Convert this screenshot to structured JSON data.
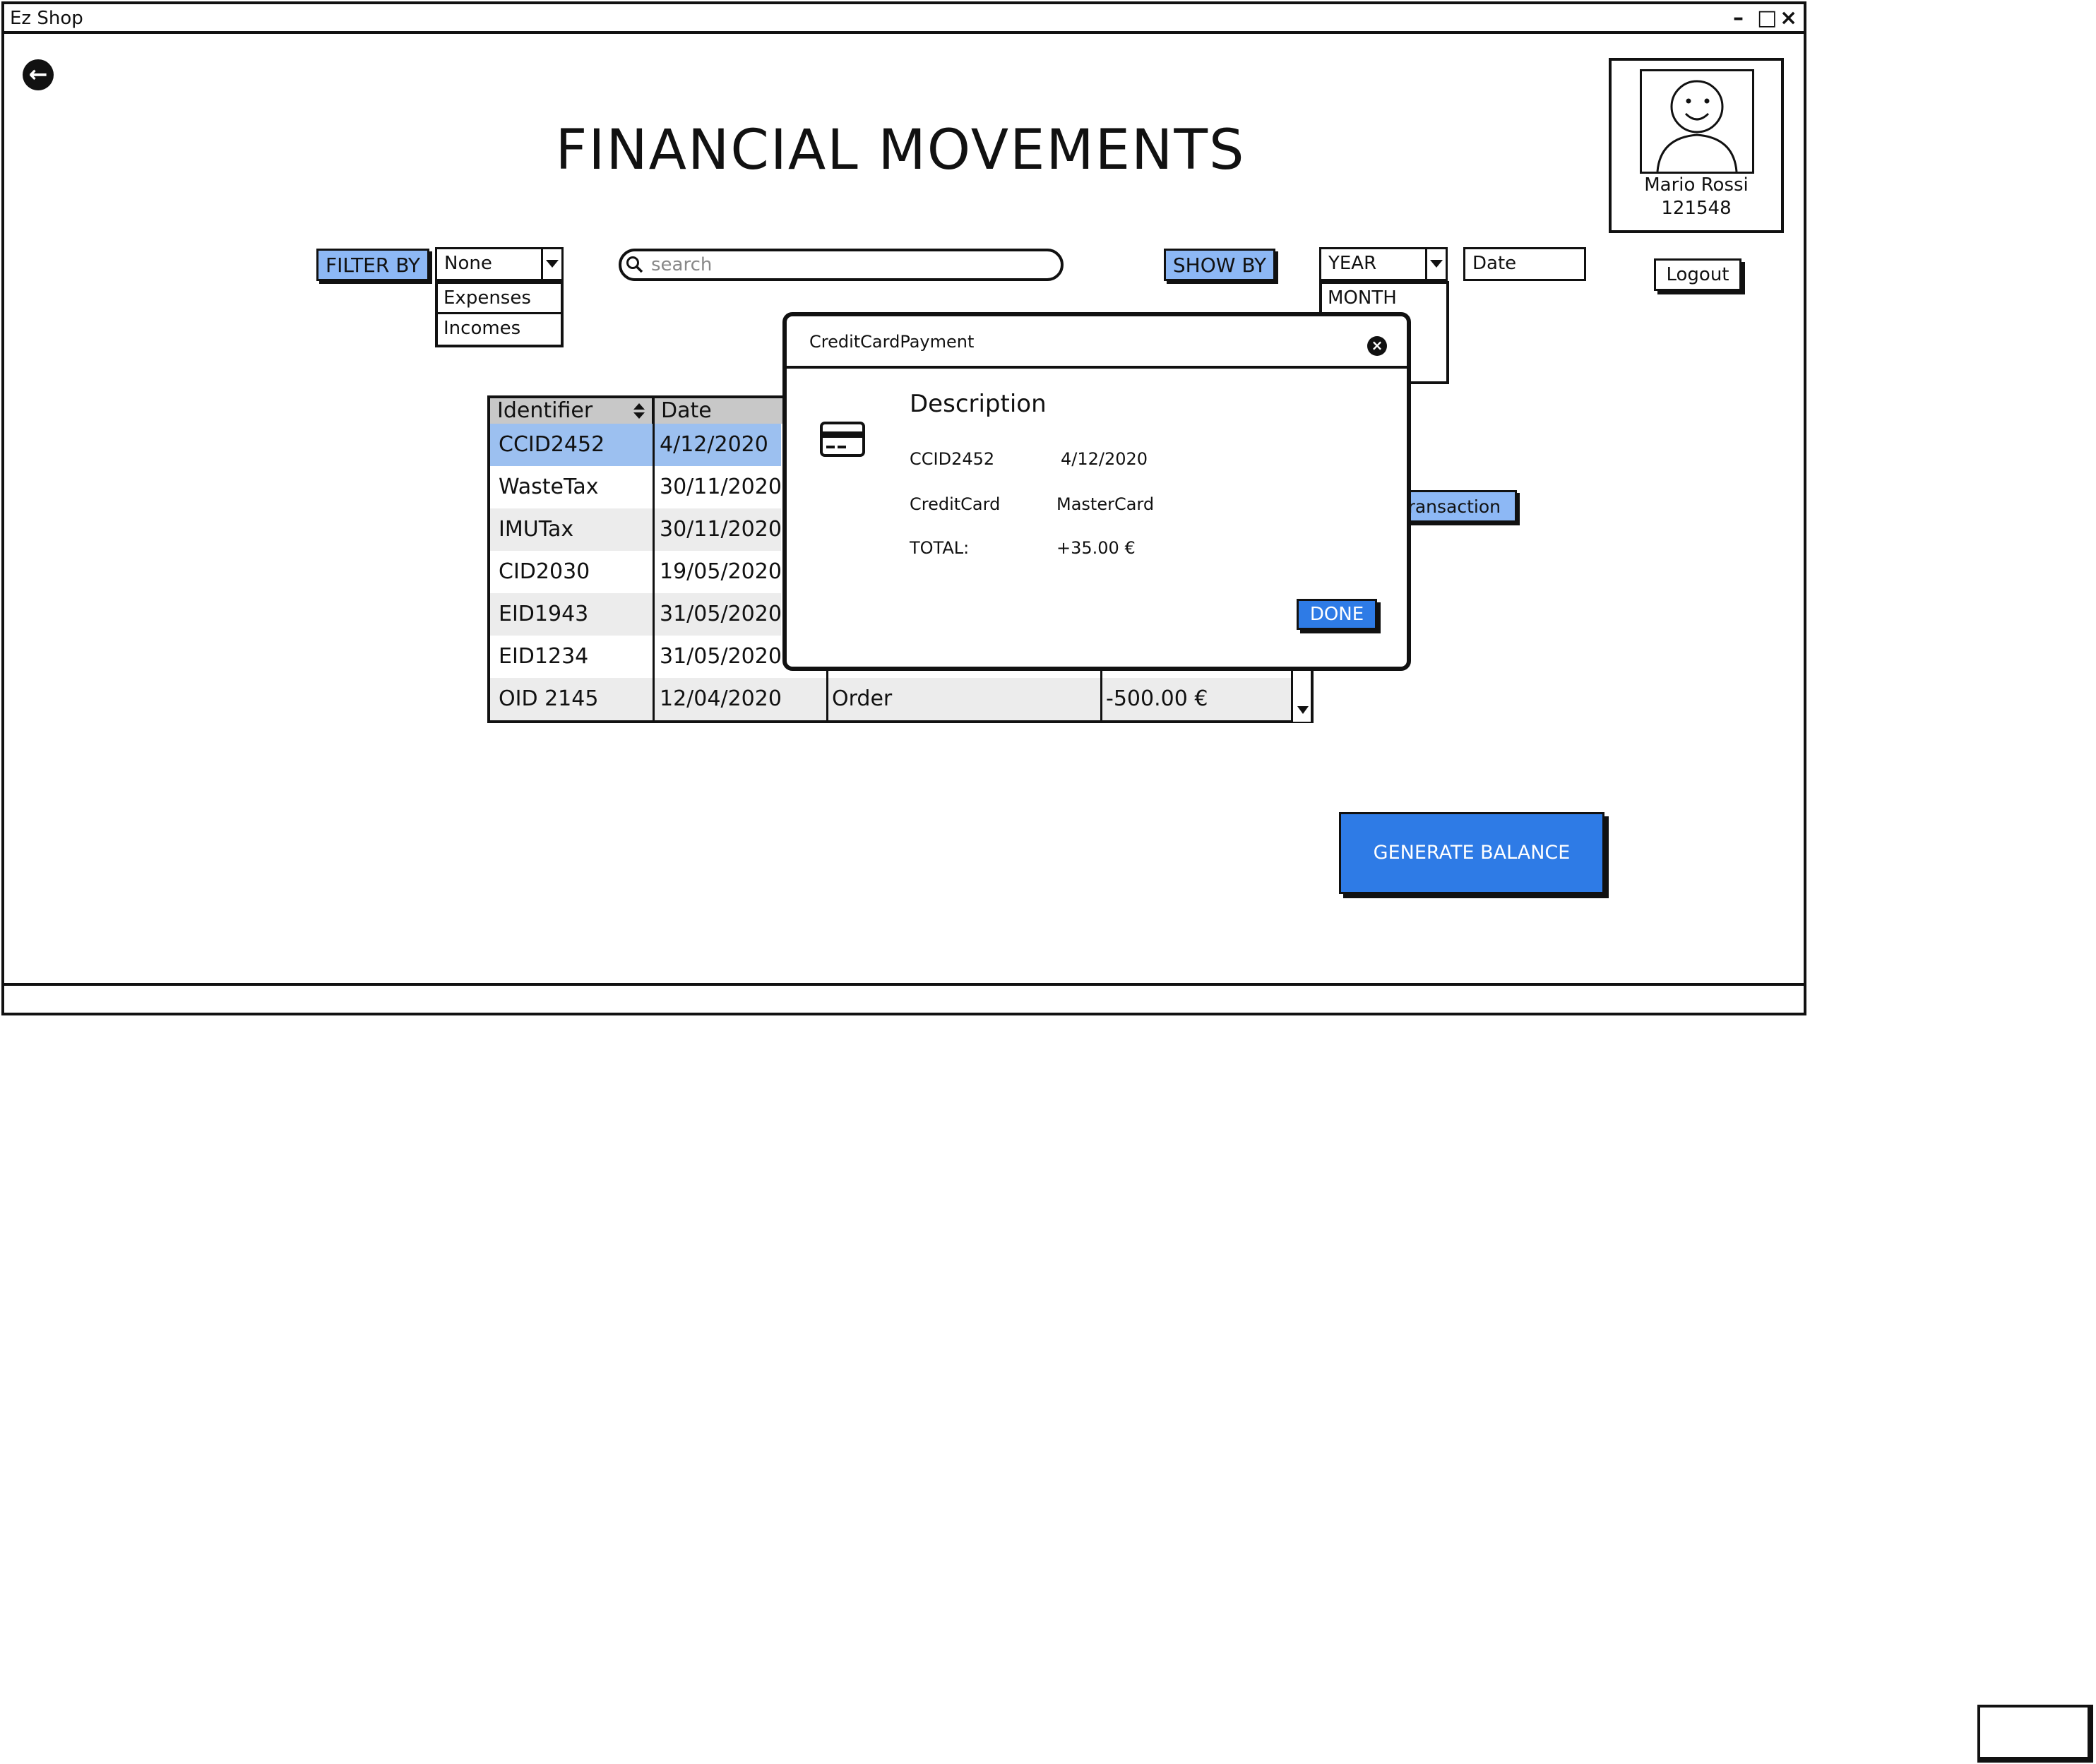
{
  "window": {
    "title": "Ez Shop",
    "controls": [
      "–",
      "□",
      "×"
    ]
  },
  "page": {
    "title": "FINANCIAL MOVEMENTS",
    "back_icon": "arrow-left-icon"
  },
  "profile": {
    "name": "Mario Rossi",
    "id": "121548",
    "logout_label": "Logout"
  },
  "filter": {
    "label": "FILTER BY",
    "selected": "None",
    "options": [
      "Expenses",
      "Incomes"
    ]
  },
  "search": {
    "placeholder": "search"
  },
  "show": {
    "label": "SHOW BY",
    "selected": "YEAR",
    "options": [
      "MONTH"
    ],
    "date_placeholder": "Date"
  },
  "table": {
    "headers": [
      "Identifier",
      "Date"
    ],
    "rows": [
      {
        "id": "CCID2452",
        "date": "4/12/2020"
      },
      {
        "id": "WasteTax",
        "date": "30/11/2020"
      },
      {
        "id": "IMUTax",
        "date": "30/11/2020"
      },
      {
        "id": "CID2030",
        "date": "19/05/2020"
      },
      {
        "id": "EID1943",
        "date": "31/05/2020"
      },
      {
        "id": "EID1234",
        "date": "31/05/2020"
      },
      {
        "id": "OID 2145",
        "date": "12/04/2020",
        "type": "Order",
        "amount": "-500.00 €"
      }
    ]
  },
  "partial_button": "ransaction",
  "modal": {
    "title": "CreditCardPayment",
    "icon": "credit-card-icon",
    "heading": "Description",
    "id": "CCID2452",
    "date": "4/12/2020",
    "card_label": "CreditCard",
    "card_value": "MasterCard",
    "total_label": "TOTAL:",
    "total_value": "+35.00 €",
    "done_label": "DONE"
  },
  "generate_label": "GENERATE BALANCE",
  "colors": {
    "accent_blue": "#2e7be6",
    "pill_blue": "#8db8f5",
    "selected_row": "#9cc0f0"
  }
}
